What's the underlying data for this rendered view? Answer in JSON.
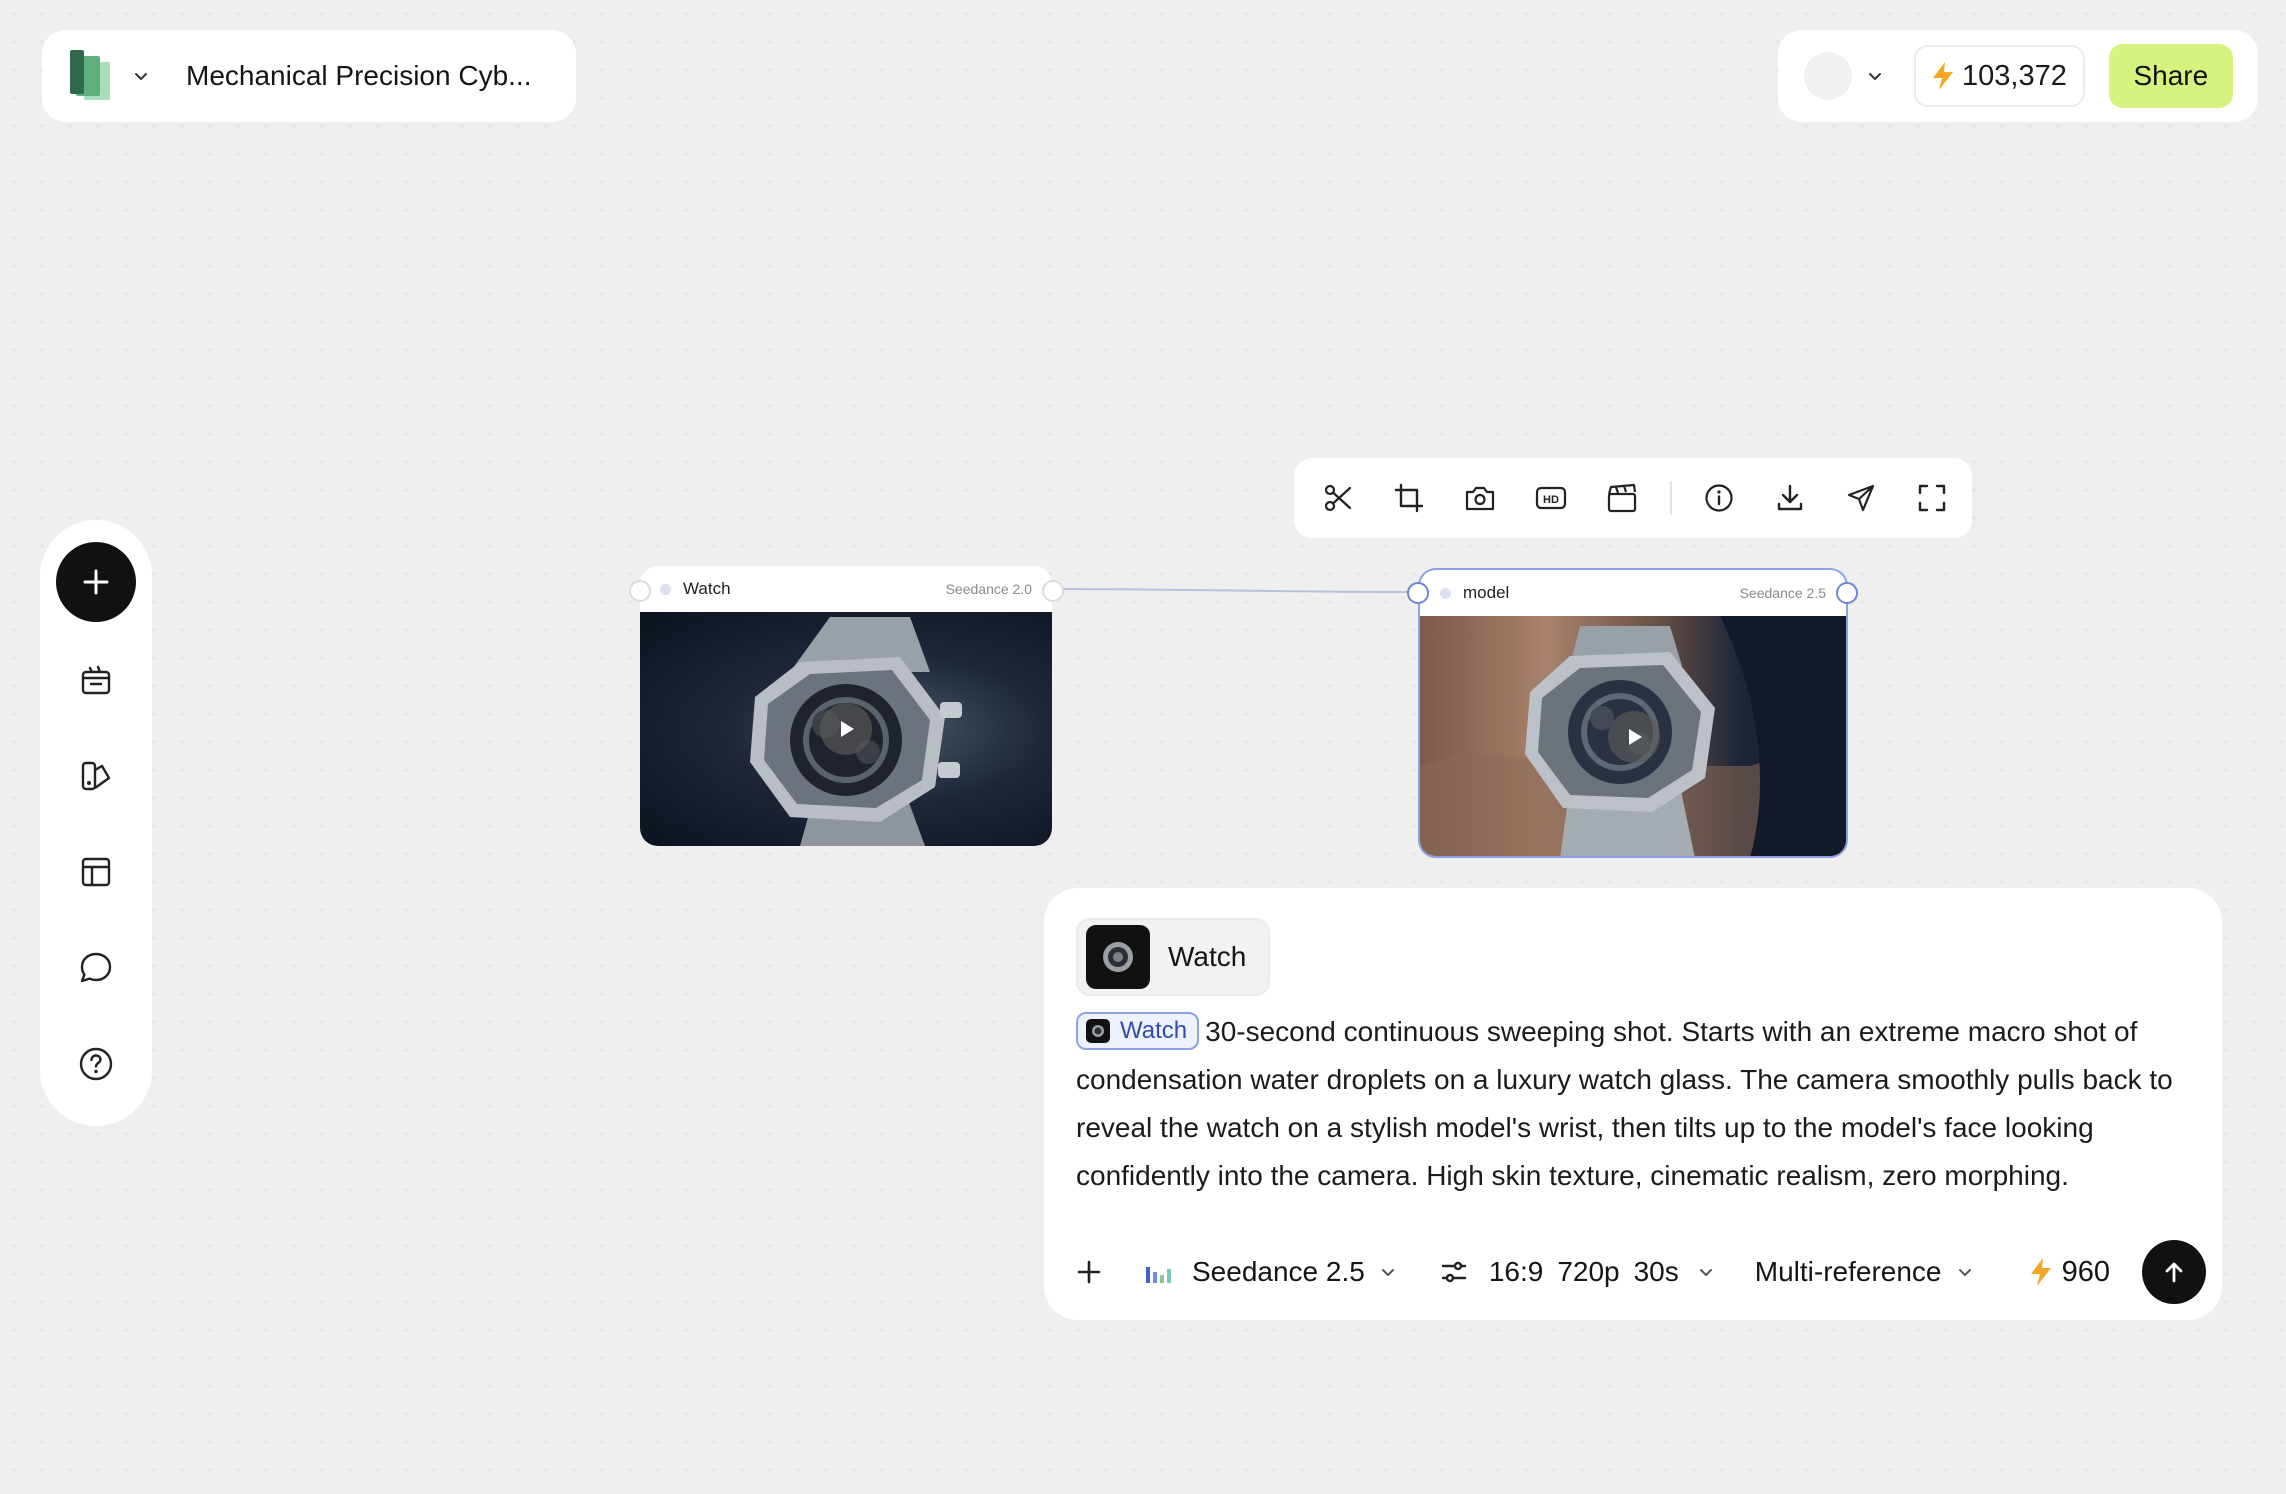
{
  "project": {
    "title": "Mechanical Precision Cyb..."
  },
  "header": {
    "credits": "103,372",
    "share_label": "Share"
  },
  "sidebar": {
    "items": [
      {
        "name": "add",
        "icon": "plus-icon"
      },
      {
        "name": "assets",
        "icon": "clapperboard-calendar-icon"
      },
      {
        "name": "styles",
        "icon": "palette-swatch-icon"
      },
      {
        "name": "templates",
        "icon": "layout-icon"
      },
      {
        "name": "chat",
        "icon": "chat-bubble-icon"
      },
      {
        "name": "help",
        "icon": "help-circle-icon"
      }
    ]
  },
  "toolbar": {
    "tools": [
      "scissors-icon",
      "crop-icon",
      "camera-icon",
      "hd-icon",
      "clapperboard-icon",
      "info-icon",
      "download-icon",
      "send-icon",
      "fullscreen-icon"
    ]
  },
  "nodes": [
    {
      "name": "Watch",
      "model": "Seedance 2.0"
    },
    {
      "name": "model",
      "model": "Seedance 2.5"
    }
  ],
  "prompt": {
    "reference_chip": "Watch",
    "inline_tag": "Watch",
    "text": "30-second continuous sweeping shot. Starts with an extreme macro shot of condensation water droplets on a luxury watch glass. The camera smoothly pulls back to reveal the watch on a stylish model's wrist, then tilts up to the model's face looking confidently into the camera. High skin texture, cinematic realism, zero morphing.",
    "model_label": "Seedance 2.5",
    "aspect": "16:9",
    "resolution": "720p",
    "duration": "30s",
    "mode": "Multi-reference",
    "cost": "960"
  },
  "colors": {
    "accent_share": "#d6f27f",
    "selection_blue": "#6b87d6",
    "lightning": "#f5a623"
  }
}
